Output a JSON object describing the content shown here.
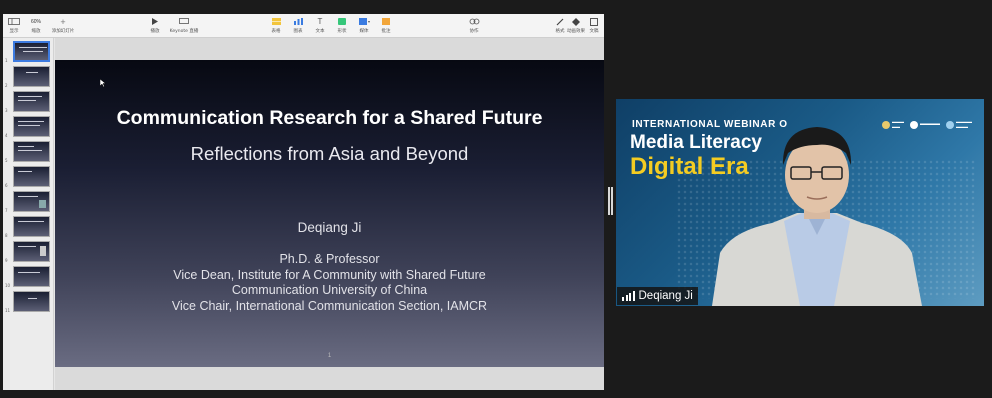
{
  "toolbar": {
    "view_label": "显示",
    "zoom_value": "60%",
    "zoom_label": "缩放",
    "add_slide_label": "添加幻灯片",
    "play_label": "播放",
    "keynote_live_label": "Keynote 直播",
    "table_label": "表格",
    "chart_label": "图表",
    "text_label": "文本",
    "shape_label": "形状",
    "media_label": "媒体",
    "comment_label": "批注",
    "collaborate_label": "协作",
    "format_label": "格式",
    "animate_label": "动画效果",
    "document_label": "文稿"
  },
  "thumbnails": [
    {
      "number": "1"
    },
    {
      "number": "2"
    },
    {
      "number": "3"
    },
    {
      "number": "4"
    },
    {
      "number": "5"
    },
    {
      "number": "6"
    },
    {
      "number": "7"
    },
    {
      "number": "8"
    },
    {
      "number": "9"
    },
    {
      "number": "10"
    },
    {
      "number": "11"
    }
  ],
  "slide": {
    "title": "Communication Research for a Shared Future",
    "subtitle": "Reflections from Asia and Beyond",
    "presenter": "Deqiang Ji",
    "info_lines": [
      "Ph.D. & Professor",
      "Vice Dean, Institute for A Community with Shared Future",
      "Communication University of China",
      "Vice Chair, International Communication Section, IAMCR"
    ],
    "page_number": "1"
  },
  "video": {
    "banner_line1": "INTERNATIONAL WEBINAR O",
    "banner_line2": "Media Literacy",
    "banner_line3": "Digital Era",
    "participant_name": "Deqiang Ji",
    "colors": {
      "banner_blue": "#14476f",
      "accent_yellow": "#f4cc22"
    }
  }
}
